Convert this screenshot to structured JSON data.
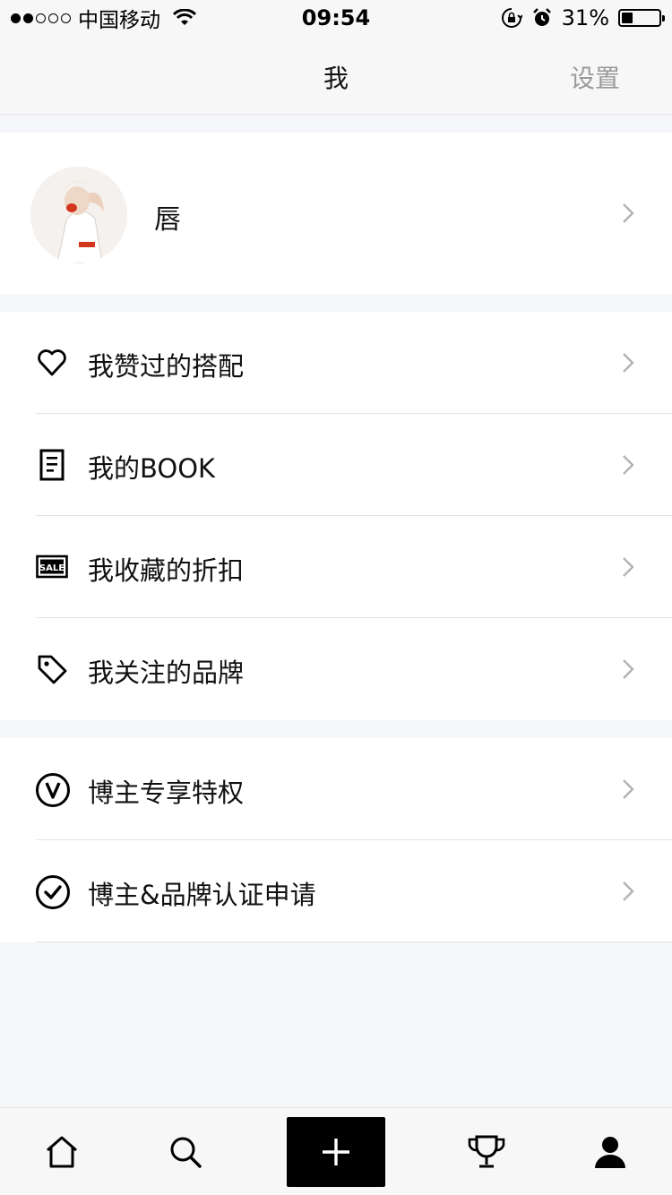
{
  "status_bar": {
    "carrier": "中国移动",
    "time": "09:54",
    "battery_percent": "31%",
    "battery_level": 0.31,
    "signal_bars": 2,
    "icons": [
      "wifi-icon",
      "rotation-lock-icon",
      "alarm-icon",
      "battery-icon"
    ]
  },
  "nav": {
    "title": "我",
    "settings_label": "设置"
  },
  "profile": {
    "name": "唇",
    "avatar": "avatar-image"
  },
  "groups": [
    {
      "items": [
        {
          "label": "我赞过的搭配",
          "icon": "heart-icon"
        },
        {
          "label": "我的BOOK",
          "icon": "book-icon"
        },
        {
          "label": "我收藏的折扣",
          "icon": "sale-icon"
        },
        {
          "label": "我关注的品牌",
          "icon": "tag-icon"
        }
      ]
    },
    {
      "items": [
        {
          "label": "博主专享特权",
          "icon": "v-badge-icon"
        },
        {
          "label": "博主&品牌认证申请",
          "icon": "check-circle-icon"
        }
      ]
    }
  ],
  "tab_bar": {
    "items": [
      "home-icon",
      "search-icon",
      "add-icon",
      "trophy-icon",
      "profile-icon"
    ],
    "active": "profile-icon"
  },
  "colors": {
    "background": "#f5f6fa",
    "settings_text": "#9a9a9a",
    "chevron": "#b3b3b3",
    "add_button": "#000000"
  }
}
